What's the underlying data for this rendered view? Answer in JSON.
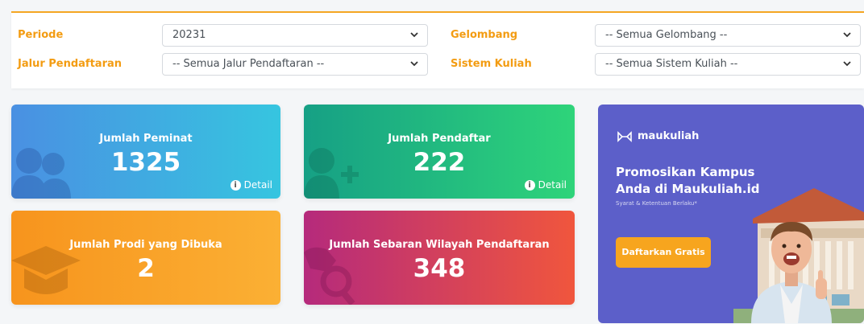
{
  "filters": {
    "periode": {
      "label": "Periode",
      "value": "20231"
    },
    "gelombang": {
      "label": "Gelombang",
      "value": "-- Semua Gelombang --"
    },
    "jalur": {
      "label": "Jalur Pendaftaran",
      "value": "-- Semua Jalur Pendaftaran --"
    },
    "sistem": {
      "label": "Sistem Kuliah",
      "value": "-- Semua Sistem Kuliah --"
    }
  },
  "stats": {
    "peminat": {
      "title": "Jumlah Peminat",
      "value": "1325",
      "detail": "Detail"
    },
    "pendaftar": {
      "title": "Jumlah Pendaftar",
      "value": "222",
      "detail": "Detail"
    },
    "prodi": {
      "title": "Jumlah Prodi yang Dibuka",
      "value": "2"
    },
    "wilayah": {
      "title": "Jumlah Sebaran Wilayah Pendaftaran",
      "value": "348"
    }
  },
  "promo": {
    "brand": "maukuliah",
    "headline_line1": "Promosikan Kampus",
    "headline_line2": "Anda di Maukuliah.id",
    "terms": "Syarat & Ketentuan Berlaku*",
    "cta": "Daftarkan Gratis"
  },
  "colors": {
    "accent": "#f39c12",
    "peminat_gradient": [
      "#4a90e2",
      "#36c5e0"
    ],
    "pendaftar_gradient": [
      "#16a085",
      "#2ed47a"
    ],
    "prodi_gradient": [
      "#f7941d",
      "#fbb034"
    ],
    "wilayah_gradient": [
      "#b52a7c",
      "#f0563d"
    ],
    "promo_bg": "#5c5fc9",
    "cta_bg": "#f7a51e"
  }
}
